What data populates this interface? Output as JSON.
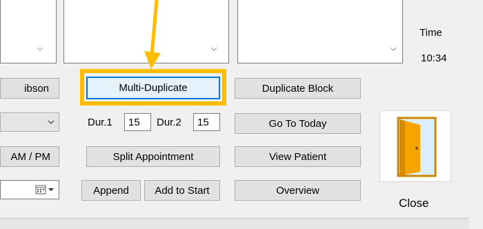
{
  "time": {
    "label": "Time",
    "value": "10:34"
  },
  "buttons": {
    "gibson": "ibson",
    "am_pm": "AM / PM",
    "multi_duplicate": "Multi-Duplicate",
    "duplicate_block": "Duplicate Block",
    "go_to_today": "Go To Today",
    "split_appointment": "Split Appointment",
    "view_patient": "View Patient",
    "append": "Append",
    "add_to_start": "Add to Start",
    "overview": "Overview",
    "close": "Close"
  },
  "duration": {
    "dur1_label": "Dur.1",
    "dur1_value": "15",
    "dur2_label": "Dur.2",
    "dur2_value": "15"
  },
  "icons": {
    "scroll_down_1": "chevron-down-icon",
    "scroll_down_2": "chevron-down-icon",
    "scroll_down_3": "chevron-down-icon",
    "combo_arrow": "chevron-down-icon",
    "date_picker": "calendar-icon",
    "close": "door-exit-icon"
  },
  "colors": {
    "highlight": "#ffbc00",
    "focus_blue": "#0078d7",
    "door_orange": "#f5a400"
  }
}
